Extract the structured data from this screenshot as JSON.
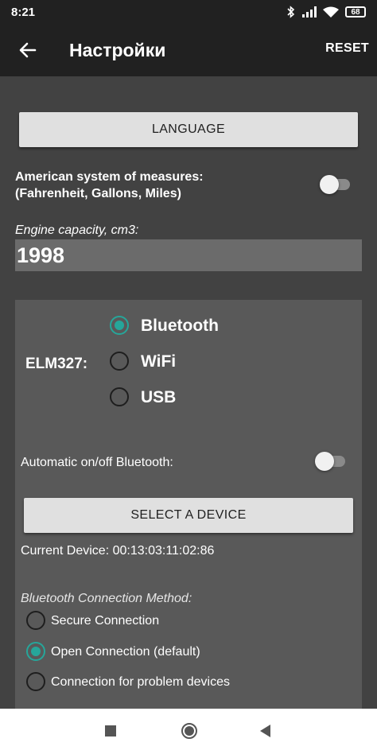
{
  "status_bar": {
    "time": "8:21",
    "battery": "68",
    "icons": [
      "bluetooth-icon",
      "signal-icon",
      "wifi-icon",
      "battery-icon"
    ]
  },
  "toolbar": {
    "title": "Настройки",
    "reset_label": "RESET",
    "back_icon": "arrow-left-icon"
  },
  "settings": {
    "language_button": "LANGUAGE",
    "american_system": {
      "label_line1": "American system of measures:",
      "label_line2": "(Fahrenheit, Gallons, Miles)",
      "enabled": false
    },
    "engine_capacity": {
      "label": "Engine capacity, cm3:",
      "value": "1998"
    },
    "elm327": {
      "label": "ELM327:",
      "options": [
        "Bluetooth",
        "WiFi",
        "USB"
      ],
      "selected": "Bluetooth"
    },
    "auto_bluetooth": {
      "label": "Automatic on/off Bluetooth:",
      "enabled": false
    },
    "select_device_button": "SELECT A DEVICE",
    "current_device": "Current Device: 00:13:03:11:02:86",
    "connection_method": {
      "label": "Bluetooth Connection Method:",
      "options": [
        "Secure Connection",
        "Open Connection (default)",
        "Connection for problem devices"
      ],
      "selected": "Open Connection (default)"
    }
  },
  "colors": {
    "accent": "#26a69a",
    "toolbar": "#212121",
    "background": "#424242",
    "card": "#595959"
  },
  "nav_bar": {
    "icons": [
      "recents-square-icon",
      "home-circle-icon",
      "back-triangle-icon"
    ]
  }
}
